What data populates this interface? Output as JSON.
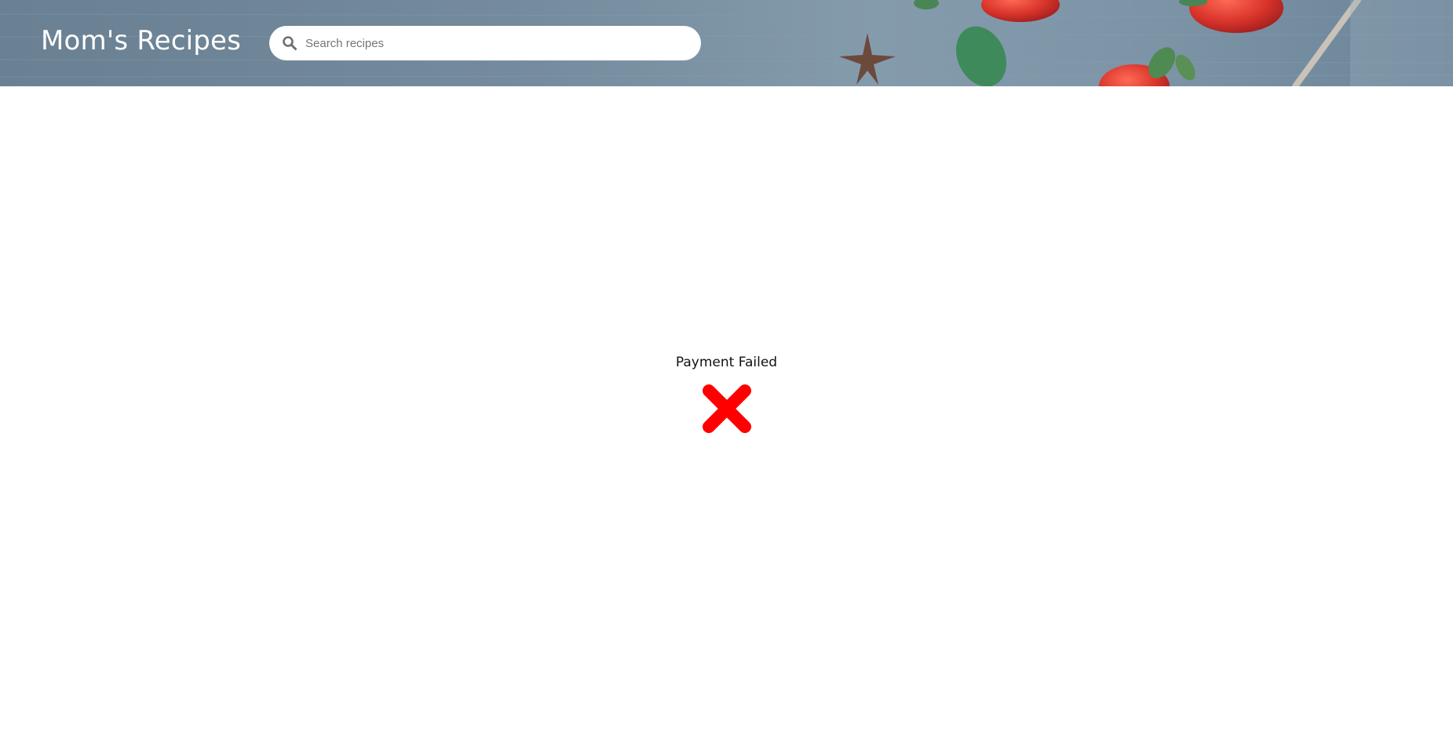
{
  "header": {
    "brand": "Mom's Recipes",
    "search": {
      "placeholder": "Search recipes",
      "value": "",
      "icon": "search-icon"
    }
  },
  "main": {
    "status_text": "Payment Failed",
    "status_icon": "close-x-icon",
    "status_color": "#ff0000"
  }
}
